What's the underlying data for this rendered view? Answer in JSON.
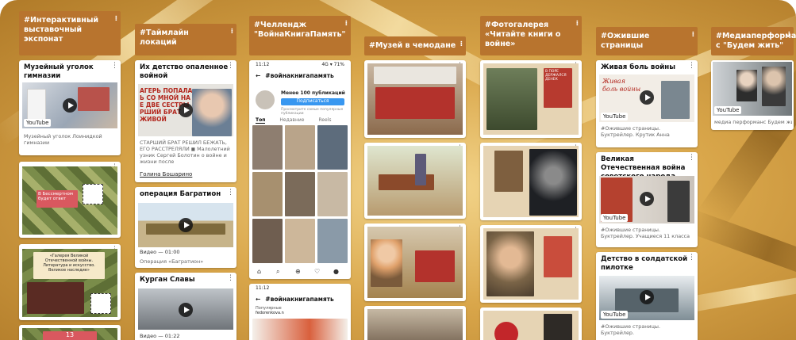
{
  "columns": [
    {
      "header": "#Интерактивный выставочный экспонат",
      "cards": [
        {
          "title": "Музейный уголок гимназии",
          "badge": "YouTube",
          "caption": "Музейный уголок Лоинидкой гимназии"
        },
        {
          "overlay": "В Бессмертном будет ответ"
        },
        {
          "overlay": "«Галерея Великой Отечественной войны. Литература и искусство. Великое наследие»"
        },
        {
          "overlay": "13"
        }
      ]
    },
    {
      "header": "#Таймлайн локаций",
      "cards": [
        {
          "title": "Их детство опаленное войной",
          "overlay": "АГЕРЬ ПОПАЛА Ь СО МНОЙ НА Е ДВЕ СЕСТРЫ РШИЙ БРАТ ЖИВОЙ",
          "caption": "СТАРШИЙ БРАТ РЕШИЛ БЕЖАТЬ, ЕГО РАССТРЕЛЯЛИ ◼ Малолетний узник Сергей Болотин о войне и жизни после",
          "link": "Голина Бошарино"
        },
        {
          "title": "операция Багратион",
          "meta": "Видео — 01:00",
          "caption": "Операция «Багратион»"
        },
        {
          "title": "Курган Славы",
          "meta": "Видео — 01:22"
        }
      ]
    },
    {
      "header": "#Челлендж \"ВойнаКнигаПамять\"",
      "phone": {
        "time": "11:12",
        "status": "4G ▾ 71%",
        "tag": "#войнакнигапамять",
        "posts": "Менее 100 публикаций",
        "follow": "Подписаться",
        "desc": "Просмотрите самые популярные публикации",
        "tabs": [
          "Топ",
          "Недавние",
          "Reels"
        ]
      },
      "phone2": {
        "time": "11:12",
        "tag": "#войнакнигапамять",
        "label": "Популярные",
        "user": "fedorenkova.n"
      }
    },
    {
      "header": "#Музей в чемодане",
      "cards": [
        {},
        {},
        {},
        {}
      ]
    },
    {
      "header": "#Фотогалерея «Читайте книги о войне»",
      "cards": [
        {
          "overlay": "В ПОРЕ ДЕРЖАЛСЯ ДЕНЕК"
        },
        {},
        {},
        {}
      ]
    },
    {
      "header": "#Ожившие страницы",
      "cards": [
        {
          "title": "Живая боль войны",
          "overlay": "Живая боль войны",
          "badge": "YouTube",
          "caption": "#Ожившие страницы. Буктрейлер. Крутик Анна"
        },
        {
          "title": "Великая Отечественная война советского народа",
          "badge": "YouTube",
          "caption": "#Ожившие страницы. Буктрейлер. Учащиеся 11 класса"
        },
        {
          "title": "Детство в солдатской пилотке",
          "badge": "YouTube",
          "caption": "#Ожившие страницы. Буктрейлер."
        }
      ]
    },
    {
      "header": "#Медиаперформан с \"Будем жить\"",
      "cards": [
        {
          "badge": "YouTube",
          "caption": "медиа перформанс Будем жить"
        }
      ]
    }
  ],
  "colors": {
    "header_bg": "#b8742e",
    "board_light": "#f3d58b",
    "board_dark": "#b07a28"
  }
}
